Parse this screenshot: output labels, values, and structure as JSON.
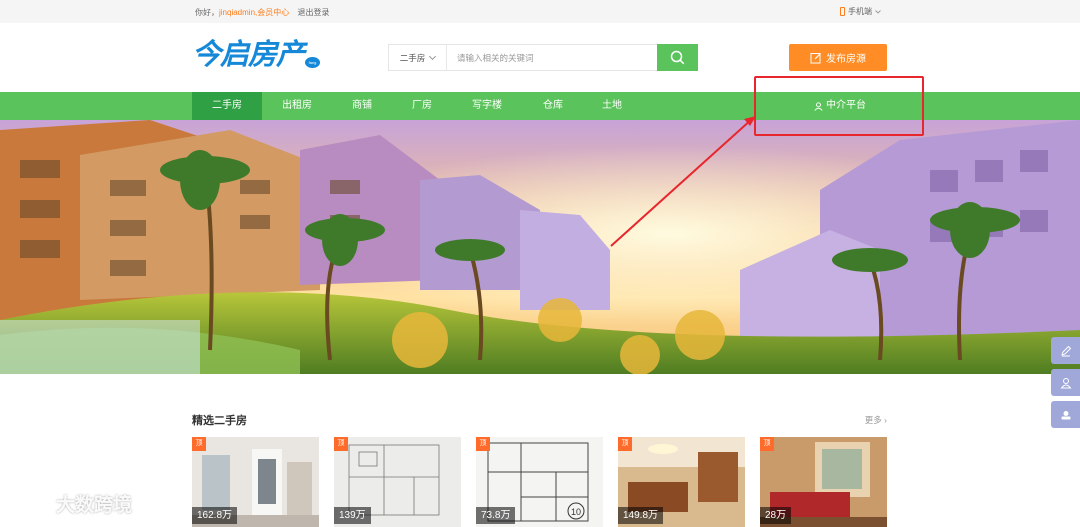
{
  "topbar": {
    "greeting": "你好，",
    "username": "jinqiadmin",
    "member_center": "会员中心",
    "logout": "退出登录",
    "mobile": "手机端"
  },
  "logo": {
    "text": "今启房产",
    "bubble": "fang"
  },
  "search": {
    "type_selected": "二手房",
    "placeholder": "请输入相关的关键词",
    "value": ""
  },
  "publish_button": "发布房源",
  "nav": {
    "items": [
      {
        "label": "二手房",
        "active": true
      },
      {
        "label": "出租房"
      },
      {
        "label": "商铺"
      },
      {
        "label": "厂房"
      },
      {
        "label": "写字楼"
      },
      {
        "label": "仓库"
      },
      {
        "label": "土地"
      }
    ],
    "agent_platform": "中介平台"
  },
  "section": {
    "title": "精选二手房",
    "more": "更多"
  },
  "listings": [
    {
      "tag": "顶",
      "price": "162.8万"
    },
    {
      "tag": "顶",
      "price": "139万"
    },
    {
      "tag": "顶",
      "price": "73.8万"
    },
    {
      "tag": "顶",
      "price": "149.8万"
    },
    {
      "tag": "顶",
      "price": "28万"
    }
  ],
  "watermark": "大数跨境",
  "colors": {
    "accent_green": "#5bc35b",
    "active_green": "#2fa043",
    "orange": "#ff8c24",
    "logo_blue": "#1688d8",
    "annotation_red": "#e8262d",
    "side_tool": "#9fa8d8"
  }
}
